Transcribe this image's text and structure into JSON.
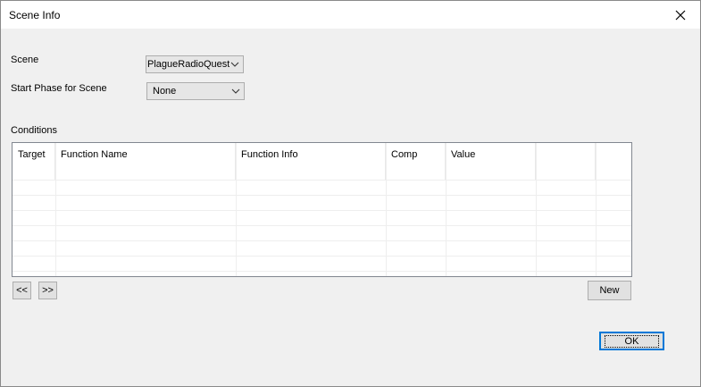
{
  "window": {
    "title": "Scene Info"
  },
  "form": {
    "scene_label": "Scene",
    "scene_value": "PlagueRadioQuest",
    "start_phase_label": "Start Phase for Scene",
    "start_phase_value": "None",
    "conditions_label": "Conditions"
  },
  "conditions_table": {
    "columns": [
      "Target",
      "Function Name",
      "Function Info",
      "Comp",
      "Value",
      "",
      ""
    ]
  },
  "buttons": {
    "prev": "<<",
    "next": ">>",
    "new": "New",
    "ok": "OK"
  }
}
